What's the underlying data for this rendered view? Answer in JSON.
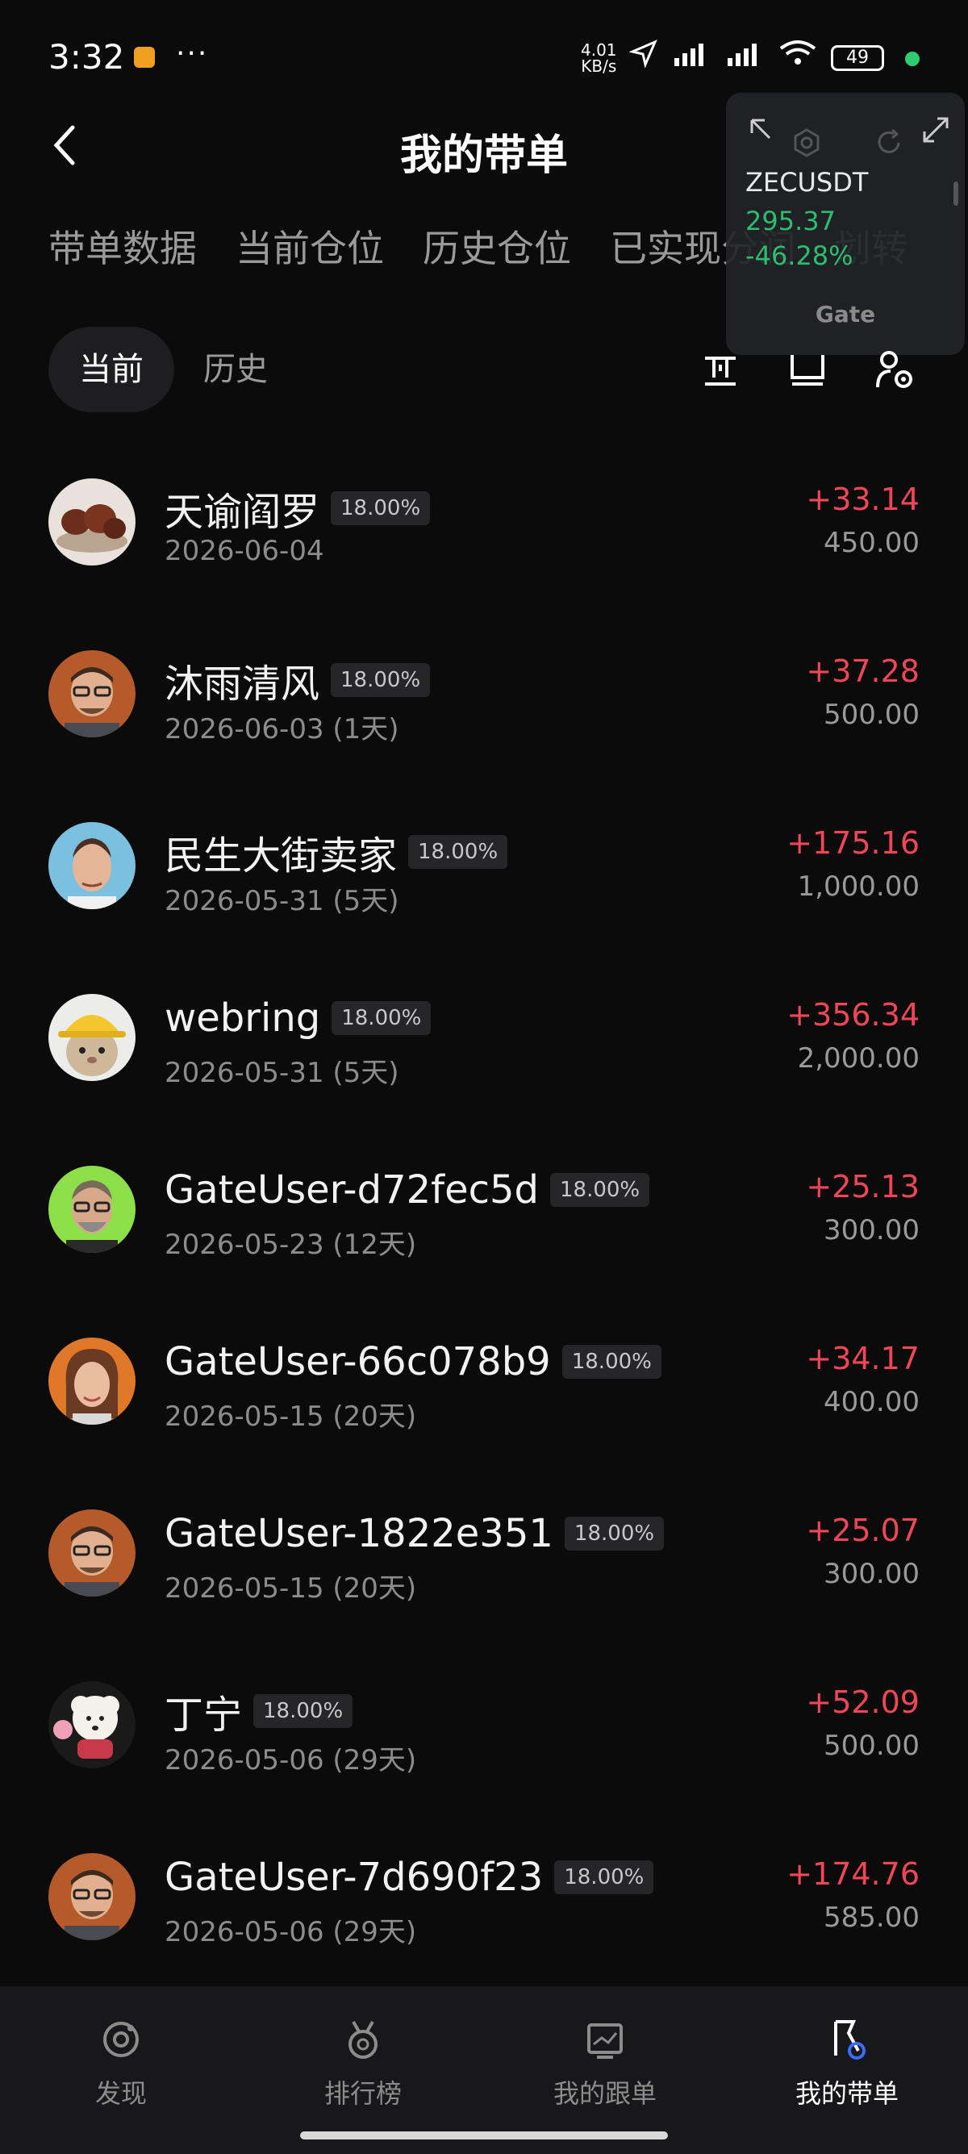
{
  "status_bar": {
    "time": "3:32",
    "more": "···",
    "net_speed_top": "4.01",
    "net_speed_unit": "KB/s",
    "battery": "49"
  },
  "header": {
    "title": "我的带单"
  },
  "tabs": [
    {
      "label": "带单数据"
    },
    {
      "label": "当前仓位"
    },
    {
      "label": "历史仓位"
    },
    {
      "label": "已实现分润"
    },
    {
      "label": "划转"
    }
  ],
  "widget": {
    "symbol": "ZECUSDT",
    "price": "295.37",
    "change": "-46.28%",
    "brand": "Gate",
    "colors": {
      "up": "#2dbd6e"
    }
  },
  "subtabs": {
    "current": "当前",
    "history": "历史"
  },
  "rows": [
    {
      "name": "天谕阎罗",
      "rate": "18.00%",
      "date": "2026-06-04",
      "pnl": "+33.14",
      "amount": "450.00",
      "avatar": "food"
    },
    {
      "name": "沐雨清风",
      "rate": "18.00%",
      "date": "2026-06-03 (1天)",
      "pnl": "+37.28",
      "amount": "500.00",
      "avatar": "man-glasses"
    },
    {
      "name": "民生大街卖家",
      "rate": "18.00%",
      "date": "2026-05-31 (5天)",
      "pnl": "+175.16",
      "amount": "1,000.00",
      "avatar": "man-blue"
    },
    {
      "name": "webring",
      "rate": "18.00%",
      "date": "2026-05-31 (5天)",
      "pnl": "+356.34",
      "amount": "2,000.00",
      "avatar": "cat-helmet"
    },
    {
      "name": "GateUser-d72fec5d",
      "rate": "18.00%",
      "date": "2026-05-23 (12天)",
      "pnl": "+25.13",
      "amount": "300.00",
      "avatar": "man-green"
    },
    {
      "name": "GateUser-66c078b9",
      "rate": "18.00%",
      "date": "2026-05-15 (20天)",
      "pnl": "+34.17",
      "amount": "400.00",
      "avatar": "woman"
    },
    {
      "name": "GateUser-1822e351",
      "rate": "18.00%",
      "date": "2026-05-15 (20天)",
      "pnl": "+25.07",
      "amount": "300.00",
      "avatar": "man-glasses"
    },
    {
      "name": "丁宁",
      "rate": "18.00%",
      "date": "2026-05-06 (29天)",
      "pnl": "+52.09",
      "amount": "500.00",
      "avatar": "dog"
    },
    {
      "name": "GateUser-7d690f23",
      "rate": "18.00%",
      "date": "2026-05-06 (29天)",
      "pnl": "+174.76",
      "amount": "585.00",
      "avatar": "man-glasses"
    }
  ],
  "bottom_nav": [
    {
      "label": "发现",
      "icon": "discover-icon"
    },
    {
      "label": "排行榜",
      "icon": "medal-icon"
    },
    {
      "label": "我的跟单",
      "icon": "chart-icon"
    },
    {
      "label": "我的带单",
      "icon": "flag-icon",
      "active": true
    }
  ],
  "colors": {
    "positive": "#f04658",
    "background": "#0b0b0b",
    "active_nav": "#3b6bff"
  }
}
